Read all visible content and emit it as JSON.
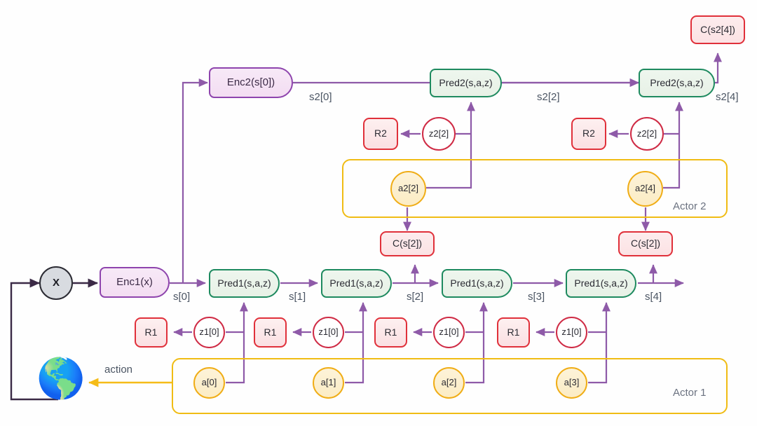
{
  "diagram": {
    "title": "Hierarchical JEPA world-model rollout",
    "background_color": "#fefefe",
    "colors": {
      "encoder_stroke": "#8e44ad",
      "predictor_stroke": "#1e8a5f",
      "cost_stroke": "#e0303a",
      "latent_stroke": "#cf2b45",
      "action_stroke": "#f0ad16",
      "actor_box_stroke": "#f0bc14",
      "arrow_purple": "#8e5aa8",
      "arrow_dark": "#3b2a46",
      "arrow_yellow": "#f5bc18",
      "label_gray": "#4b5563"
    }
  },
  "world": {
    "globe_icon": "🌎",
    "observation_label": "X",
    "action_edge_label": "action"
  },
  "encoders": [
    {
      "id": "enc1",
      "label": "Enc1(x)"
    },
    {
      "id": "enc2",
      "label": "Enc2(s[0])"
    }
  ],
  "level1": {
    "predictors": [
      {
        "id": "pred1_0",
        "label": "Pred1(s,a,z)"
      },
      {
        "id": "pred1_1",
        "label": "Pred1(s,a,z)"
      },
      {
        "id": "pred1_2",
        "label": "Pred1(s,a,z)"
      },
      {
        "id": "pred1_3",
        "label": "Pred1(s,a,z)"
      }
    ],
    "state_labels": [
      "s[0]",
      "s[1]",
      "s[2]",
      "s[3]",
      "s[4]"
    ],
    "regularizers": [
      "R1",
      "R1",
      "R1",
      "R1"
    ],
    "latents": [
      "z1[0]",
      "z1[0]",
      "z1[0]",
      "z1[0]"
    ],
    "actions": [
      "a[0]",
      "a[1]",
      "a[2]",
      "a[3]"
    ],
    "actor_label": "Actor 1"
  },
  "level2": {
    "predictors": [
      {
        "id": "pred2_0",
        "label": "Pred2(s,a,z)"
      },
      {
        "id": "pred2_1",
        "label": "Pred2(s,a,z)"
      }
    ],
    "state_labels": [
      "s2[0]",
      "s2[2]",
      "s2[4]"
    ],
    "regularizers": [
      "R2",
      "R2"
    ],
    "latents": [
      "z2[2]",
      "z2[2]"
    ],
    "actions": [
      "a2[2]",
      "a2[4]"
    ],
    "actor_label": "Actor 2"
  },
  "costs": [
    {
      "id": "cost_s2_4",
      "label": "C(s2[4])"
    },
    {
      "id": "cost_s_2_left",
      "label": "C(s[2])"
    },
    {
      "id": "cost_s_2_right",
      "label": "C(s[2])"
    }
  ]
}
